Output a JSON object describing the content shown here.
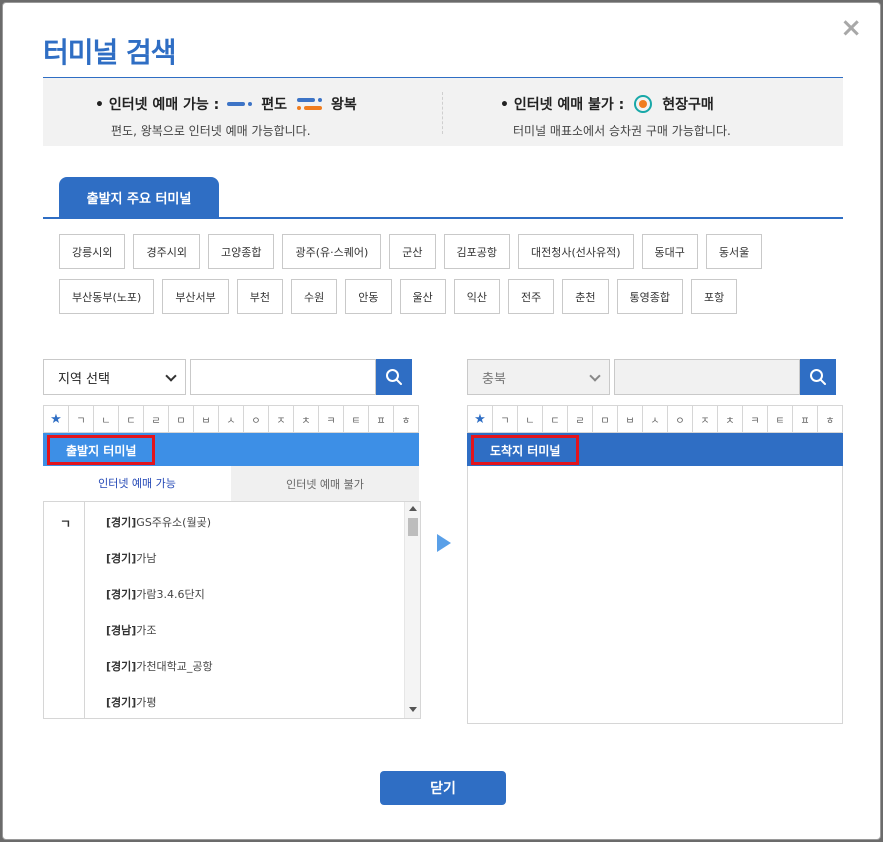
{
  "modal": {
    "title": "터미널 검색",
    "close_glyph": "×"
  },
  "legend": {
    "left_head": "• 인터넷 예매 가능 :",
    "oneway_label": "편도",
    "roundtrip_label": "왕복",
    "left_desc": "편도, 왕복으로 인터넷 예매 가능합니다.",
    "right_head": "• 인터넷 예매 불가 :",
    "onsite_label": "현장구매",
    "right_desc": "터미널 매표소에서 승차권 구매 가능합니다.",
    "oneway_color": "#3d74c6",
    "roundtrip_colors": [
      "#3d74c6",
      "#f07d1f"
    ],
    "onsite_colors": [
      "#18a8a8",
      "#f07d1f"
    ]
  },
  "main_tab": {
    "label": "출발지 주요 터미널"
  },
  "terminals_row1": [
    "강릉시외",
    "경주시외",
    "고양종합",
    "광주(유·스퀘어)",
    "군산",
    "김포공항",
    "대전청사(선사유적)",
    "동대구",
    "동서울"
  ],
  "terminals_row2": [
    "부산동부(노포)",
    "부산서부",
    "부천",
    "수원",
    "안동",
    "울산",
    "익산",
    "전주",
    "춘천",
    "통영종합",
    "포항"
  ],
  "consonants": [
    "ㄱ",
    "ㄴ",
    "ㄷ",
    "ㄹ",
    "ㅁ",
    "ㅂ",
    "ㅅ",
    "ㅇ",
    "ㅈ",
    "ㅊ",
    "ㅋ",
    "ㅌ",
    "ㅍ",
    "ㅎ"
  ],
  "departure": {
    "region_select": "지역 선택",
    "bar_label": "출발지 터미널",
    "subtab_available": "인터넷 예매 가능",
    "subtab_unavailable": "인터넷 예매 불가",
    "group_label": "ㄱ",
    "items": [
      {
        "region": "[경기]",
        "name": "GS주유소(월곶)"
      },
      {
        "region": "[경기]",
        "name": "가남"
      },
      {
        "region": "[경기]",
        "name": "가람3.4.6단지"
      },
      {
        "region": "[경남]",
        "name": "가조"
      },
      {
        "region": "[경기]",
        "name": "가천대학교_공항"
      },
      {
        "region": "[경기]",
        "name": "가평"
      }
    ]
  },
  "arrival": {
    "region_select": "충북",
    "bar_label": "도착지 터미널"
  },
  "footer": {
    "close_label": "닫기"
  },
  "colors": {
    "accent": "#2f6ec4",
    "bar_light": "#3d8fe6",
    "highlight": "#e3141c"
  }
}
